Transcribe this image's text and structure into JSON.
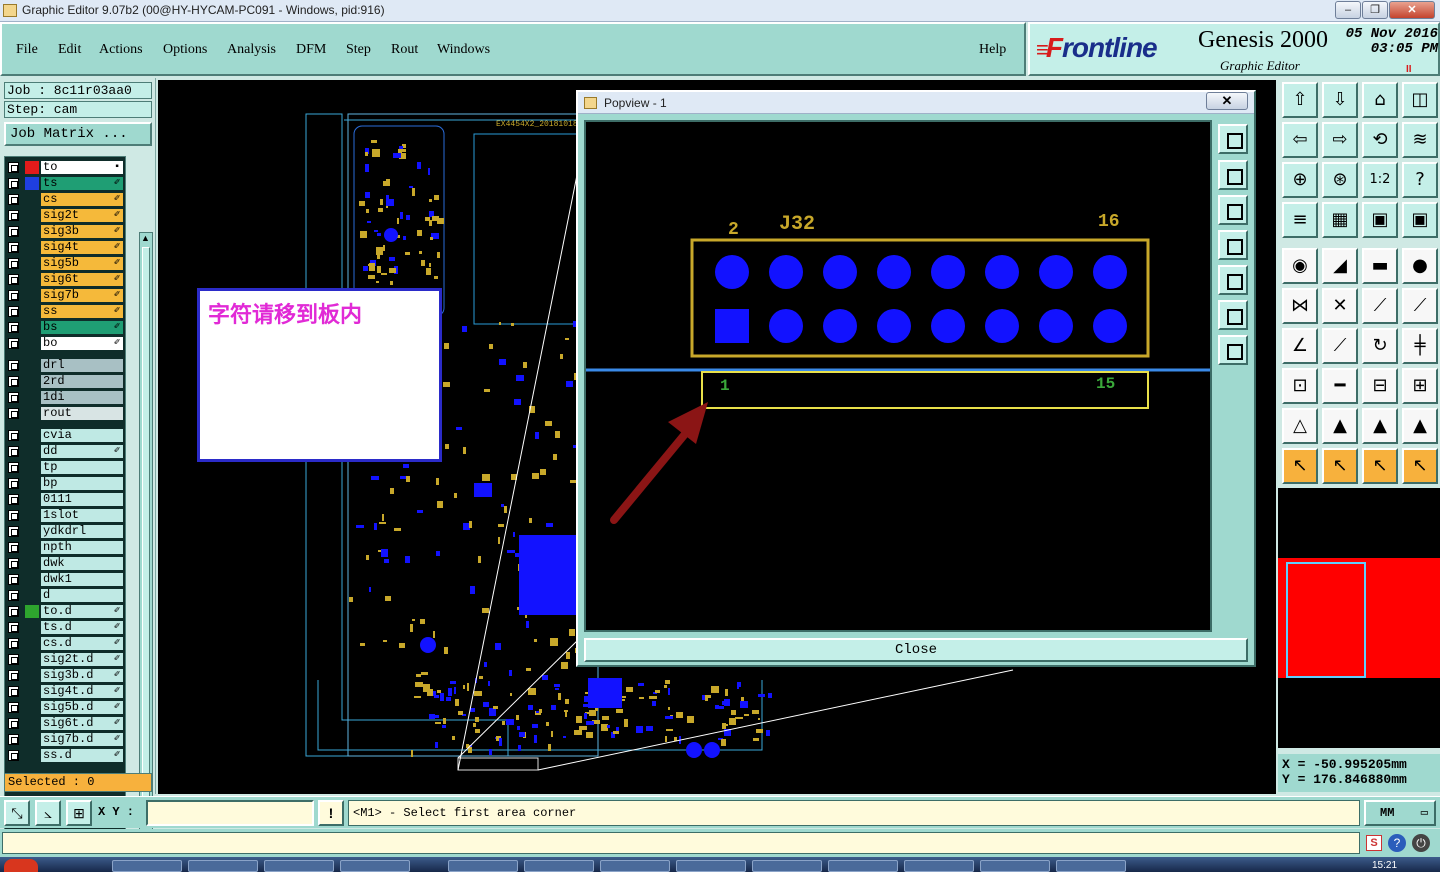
{
  "window": {
    "title": "Graphic Editor 9.07b2 (00@HY-HYCAM-PC091 - Windows, pid:916)"
  },
  "menu": {
    "file": "File",
    "edit": "Edit",
    "actions": "Actions",
    "options": "Options",
    "analysis": "Analysis",
    "dfm": "DFM",
    "step": "Step",
    "rout": "Rout",
    "windows": "Windows",
    "help": "Help"
  },
  "brand": {
    "logo_f": "F",
    "logo_rest": "rontline",
    "product": "Genesis 2000",
    "subtitle": "Graphic Editor",
    "date": "05 Nov 2016",
    "time": "03:05 PM",
    "pause": "II"
  },
  "job": {
    "job_label": "Job : 8c11r03aa0",
    "step_label": "Step: cam",
    "job_matrix": "Job Matrix ..."
  },
  "layers": [
    {
      "name": "to",
      "color": "#ffffff",
      "swatch": "#e21b1b",
      "edit": "▪"
    },
    {
      "name": "ts",
      "color": "#1f9e74",
      "swatch": "#1f3fe0",
      "edit": "✐"
    },
    {
      "name": "cs",
      "color": "#f5b93a",
      "swatch": "",
      "edit": "✐"
    },
    {
      "name": "sig2t",
      "color": "#f5b93a",
      "swatch": "",
      "edit": "✐"
    },
    {
      "name": "sig3b",
      "color": "#f5b93a",
      "swatch": "",
      "edit": "✐"
    },
    {
      "name": "sig4t",
      "color": "#f5b93a",
      "swatch": "",
      "edit": "✐"
    },
    {
      "name": "sig5b",
      "color": "#f5b93a",
      "swatch": "",
      "edit": "✐"
    },
    {
      "name": "sig6t",
      "color": "#f5b93a",
      "swatch": "",
      "edit": "✐"
    },
    {
      "name": "sig7b",
      "color": "#f5b93a",
      "swatch": "",
      "edit": "✐"
    },
    {
      "name": "ss",
      "color": "#f5b93a",
      "swatch": "",
      "edit": "✐"
    },
    {
      "name": "bs",
      "color": "#1f9e74",
      "swatch": "",
      "edit": "✐"
    },
    {
      "name": "bo",
      "color": "#ffffff",
      "swatch": "",
      "edit": "✐"
    },
    {
      "name": "drl",
      "color": "#a8c0c4",
      "swatch": "",
      "edit": ""
    },
    {
      "name": "2rd",
      "color": "#a8c0c4",
      "swatch": "",
      "edit": ""
    },
    {
      "name": "1di",
      "color": "#a8c0c4",
      "swatch": "",
      "edit": ""
    },
    {
      "name": "rout",
      "color": "#d8e4e4",
      "swatch": "",
      "edit": ""
    },
    {
      "name": "cvia",
      "color": "#bfe9e4",
      "swatch": "",
      "edit": ""
    },
    {
      "name": "dd",
      "color": "#bfe9e4",
      "swatch": "",
      "edit": "✐"
    },
    {
      "name": "tp",
      "color": "#bfe9e4",
      "swatch": "",
      "edit": ""
    },
    {
      "name": "bp",
      "color": "#bfe9e4",
      "swatch": "",
      "edit": ""
    },
    {
      "name": "0111",
      "color": "#bfe9e4",
      "swatch": "",
      "edit": ""
    },
    {
      "name": "1slot",
      "color": "#bfe9e4",
      "swatch": "",
      "edit": ""
    },
    {
      "name": "ydkdrl",
      "color": "#bfe9e4",
      "swatch": "",
      "edit": ""
    },
    {
      "name": "npth",
      "color": "#bfe9e4",
      "swatch": "",
      "edit": ""
    },
    {
      "name": "dwk",
      "color": "#bfe9e4",
      "swatch": "",
      "edit": ""
    },
    {
      "name": "dwk1",
      "color": "#bfe9e4",
      "swatch": "",
      "edit": ""
    },
    {
      "name": "d",
      "color": "#bfe9e4",
      "swatch": "",
      "edit": ""
    },
    {
      "name": "to.d",
      "color": "#bfe9e4",
      "swatch": "#2ea52e",
      "edit": "✐"
    },
    {
      "name": "ts.d",
      "color": "#bfe9e4",
      "swatch": "",
      "edit": "✐"
    },
    {
      "name": "cs.d",
      "color": "#bfe9e4",
      "swatch": "",
      "edit": "✐"
    },
    {
      "name": "sig2t.d",
      "color": "#bfe9e4",
      "swatch": "",
      "edit": "✐"
    },
    {
      "name": "sig3b.d",
      "color": "#bfe9e4",
      "swatch": "",
      "edit": "✐"
    },
    {
      "name": "sig4t.d",
      "color": "#bfe9e4",
      "swatch": "",
      "edit": "✐"
    },
    {
      "name": "sig5b.d",
      "color": "#bfe9e4",
      "swatch": "",
      "edit": "✐"
    },
    {
      "name": "sig6t.d",
      "color": "#bfe9e4",
      "swatch": "",
      "edit": "✐"
    },
    {
      "name": "sig7b.d",
      "color": "#bfe9e4",
      "swatch": "",
      "edit": "✐"
    },
    {
      "name": "ss.d",
      "color": "#bfe9e4",
      "swatch": "",
      "edit": "✐"
    }
  ],
  "selected": "Selected : 0",
  "canvas": {
    "board_label": "EX4454X2_20181018",
    "note_text": "字符请移到板内"
  },
  "popview": {
    "title": "Popview - 1",
    "close_x": "✕",
    "close_button": "Close",
    "connector": {
      "ref": "J32",
      "pin_top_left": "2",
      "pin_top_right": "16",
      "pin_bottom_left": "1",
      "pin_bottom_right": "15"
    }
  },
  "coords": {
    "x": "X = -50.995205mm",
    "y": "Y = 176.846880mm"
  },
  "status": {
    "xy_label": "X Y :",
    "xy_value": "",
    "prompt": "<M1> - Select first area corner",
    "unit": "MM"
  },
  "clock": "15:21",
  "colors": {
    "panel": "#9fd9cf",
    "accent": "#f7b13d",
    "canvas": "#000000",
    "pad": "#1212ff",
    "outline": "#c8a82a"
  }
}
